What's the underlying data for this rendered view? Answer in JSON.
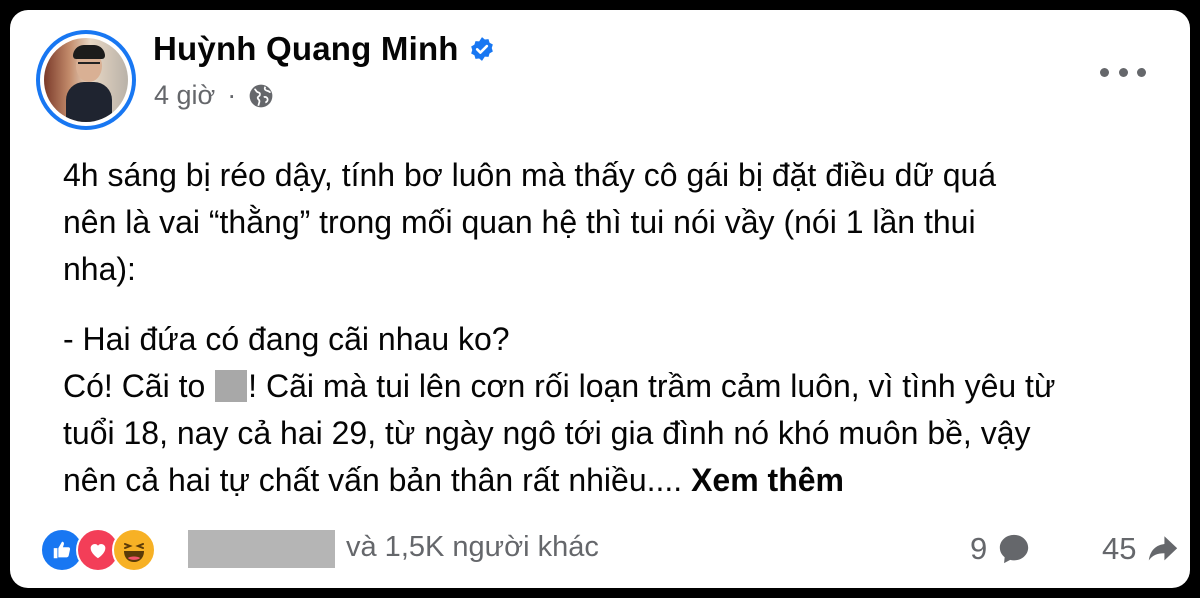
{
  "post": {
    "author": "Huỳnh Quang Minh",
    "time": "4 giờ",
    "dot": "·",
    "text_lines": [
      "4h sáng bị réo dậy, tính bơ luôn mà thấy cô gái bị đặt điều dữ quá",
      "nên là vai “thằng” trong mối quan hệ thì tui nói vầy (nói 1 lần thui",
      "nha):"
    ],
    "question": "- Hai đứa có đang cãi nhau ko?",
    "answer_start": "Có! Cãi to ",
    "answer_rest_line1": "! Cãi mà tui lên cơn rối loạn trầm cảm luôn, vì tình yêu từ",
    "answer_line2": "tuổi 18, nay cả hai 29, từ ngày ngô tới gia đình nó khó muôn bề, vậy",
    "answer_line3": "nên cả hai tự chất vấn bản thân rất nhiều.... ",
    "see_more": "Xem thêm"
  },
  "footer": {
    "reactions": [
      "like-icon",
      "love-icon",
      "haha-icon"
    ],
    "others_text": "và 1,5K người khác",
    "comment_count": "9",
    "share_count": "45"
  },
  "colors": {
    "brand_blue": "#1877f2",
    "secondary_text": "#65676b",
    "primary_text": "#050505"
  }
}
